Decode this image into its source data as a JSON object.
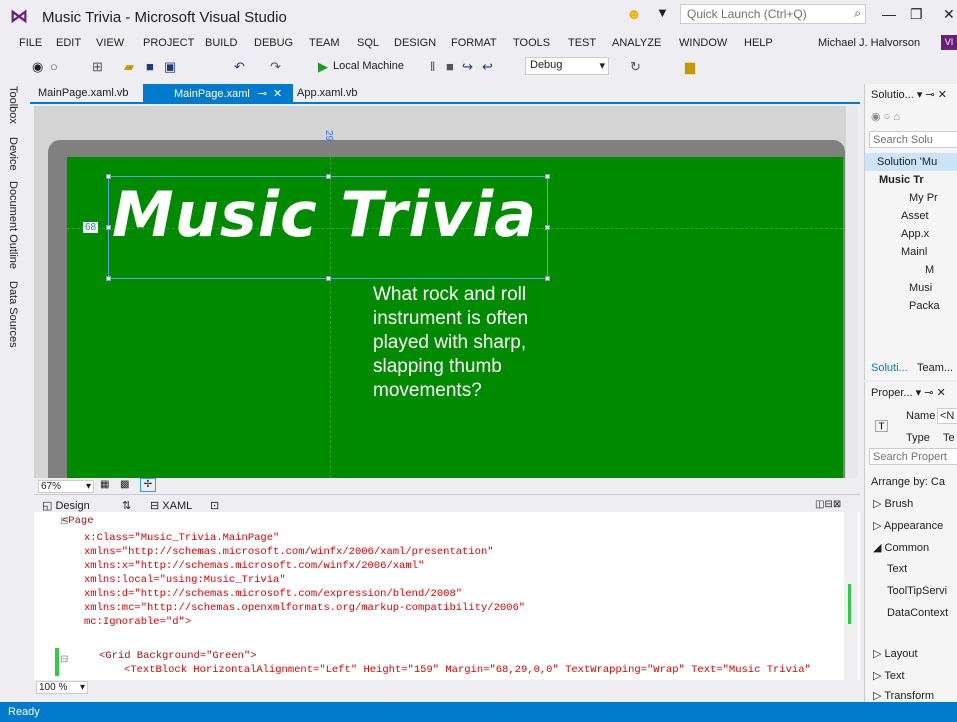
{
  "window": {
    "title": "Music Trivia - Microsoft Visual Studio",
    "quick_launch": "Quick Launch (Ctrl+Q)"
  },
  "menu": [
    "FILE",
    "EDIT",
    "VIEW",
    "PROJECT",
    "BUILD",
    "DEBUG",
    "TEAM",
    "SQL",
    "DESIGN",
    "FORMAT",
    "TOOLS",
    "TEST",
    "ANALYZE",
    "WINDOW",
    "HELP"
  ],
  "user": {
    "name": "Michael J. Halvorson",
    "badge": "VI"
  },
  "toolbar": {
    "run_target": "Local Machine",
    "config": "Debug"
  },
  "left_tabs": [
    "Toolbox",
    "Device",
    "Document Outline",
    "Data Sources"
  ],
  "tabs": {
    "tab1": "MainPage.xaml.vb",
    "tab2": "MainPage.xaml",
    "tab3": "App.xaml.vb"
  },
  "design": {
    "title": "Music Trivia",
    "question": "What rock and roll instrument is often played with sharp, slapping thumb movements?",
    "margin_top": "29",
    "margin_left": "68",
    "zoom": "67%"
  },
  "splitter": {
    "design": "Design",
    "xaml": "XAML"
  },
  "xaml": {
    "line1": "<Page",
    "line2": "x:Class=\"Music_Trivia.MainPage\"",
    "line3": "xmlns=\"http://schemas.microsoft.com/winfx/2006/xaml/presentation\"",
    "line4": "xmlns:x=\"http://schemas.microsoft.com/winfx/2006/xaml\"",
    "line5": "xmlns:local=\"using:Music_Trivia\"",
    "line6": "xmlns:d=\"http://schemas.microsoft.com/expression/blend/2008\"",
    "line7": "xmlns:mc=\"http://schemas.openxmlformats.org/markup-compatibility/2006\"",
    "line8": "mc:Ignorable=\"d\">",
    "line9": "<Grid Background=\"Green\">",
    "line10": "<TextBlock HorizontalAlignment=\"Left\" Height=\"159\" Margin=\"68,29,0,0\" TextWrapping=\"Wrap\" Text=\"Music Trivia\"",
    "zoom": "100 %"
  },
  "solution": {
    "title": "Solutio...",
    "search": "Search Solu",
    "items": [
      "Solution 'Mu",
      "Music Tr",
      "My Pr",
      "Asset",
      "App.x",
      "Mainl",
      "M",
      "Musi",
      "Packa"
    ],
    "tabs": [
      "Soluti...",
      "Team..."
    ]
  },
  "properties": {
    "title": "Proper...",
    "name_label": "Name",
    "name_value": "<N",
    "type_label": "Type",
    "type_value": "Te",
    "search": "Search Propert",
    "arrange": "Arrange by: Ca",
    "categories": [
      "Brush",
      "Appearance",
      "Common",
      "Text",
      "ToolTipServi",
      "DataContext",
      "Layout",
      "Text",
      "Transform"
    ]
  },
  "status": "Ready"
}
